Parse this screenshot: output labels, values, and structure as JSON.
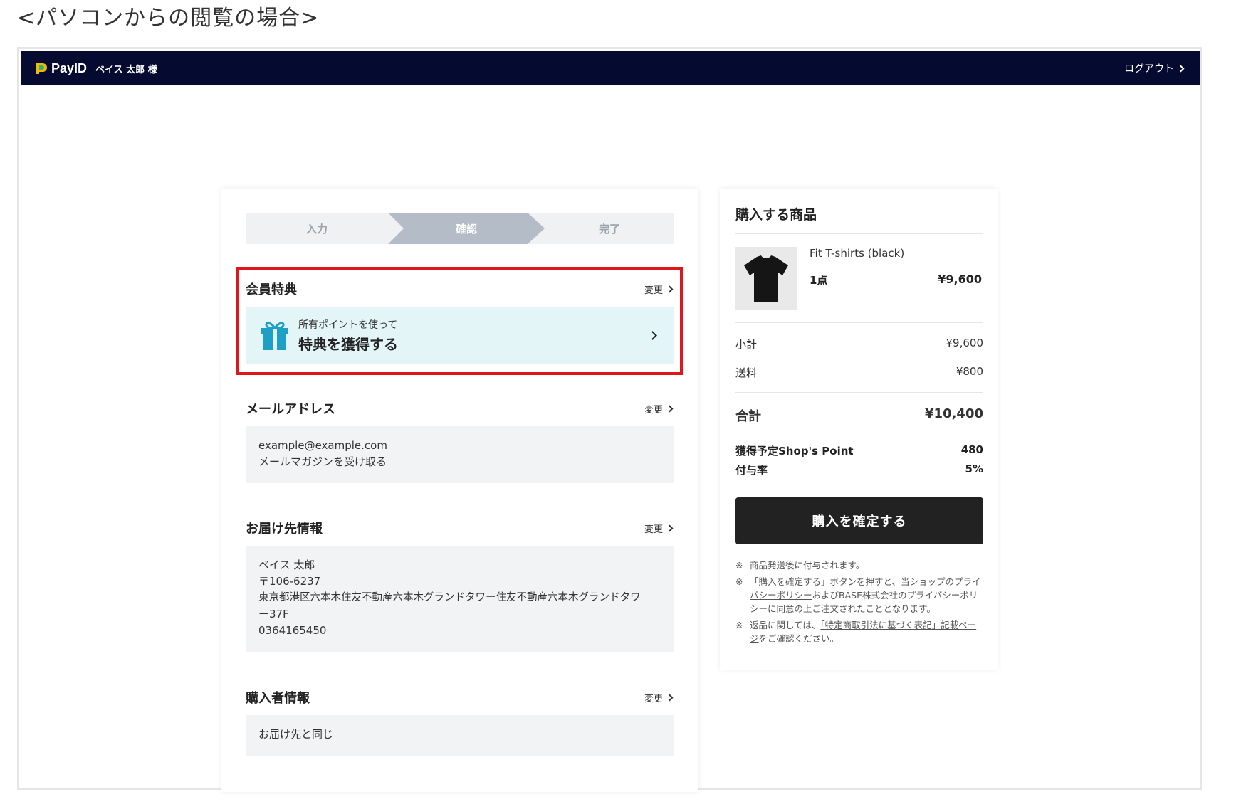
{
  "caption": "<パソコンからの閲覧の場合>",
  "header": {
    "brand": "PayID",
    "user": "ベイス 太郎 様",
    "logout": "ログアウト"
  },
  "stepper": {
    "steps": [
      "入力",
      "確認",
      "完了"
    ],
    "active_index": 1
  },
  "member_benefit": {
    "title": "会員特典",
    "change": "変更",
    "sub": "所有ポイントを使って",
    "main": "特典を獲得する"
  },
  "email": {
    "title": "メールアドレス",
    "change": "変更",
    "address": "example@example.com",
    "newsletter": "メールマガジンを受け取る"
  },
  "shipping": {
    "title": "お届け先情報",
    "change": "変更",
    "name": "ベイス 太郎",
    "postal": "〒106-6237",
    "address_line1": "東京都港区六本木住友不動産六本木グランドタワー住友不動産六本木グランドタワ",
    "address_line2": "ー37F",
    "phone": "0364165450"
  },
  "buyer": {
    "title": "購入者情報",
    "change": "変更",
    "value": "お届け先と同じ"
  },
  "order": {
    "title": "購入する商品",
    "product_name": "Fit T-shirts (black)",
    "quantity": "1点",
    "price": "¥9,600",
    "subtotal_label": "小計",
    "subtotal": "¥9,600",
    "shipping_label": "送料",
    "shipping": "¥800",
    "total_label": "合計",
    "total": "¥10,400",
    "points_label": "獲得予定Shop's Point",
    "points": "480",
    "rate_label": "付与率",
    "rate": "5%",
    "buy_button": "購入を確定する",
    "note1": "商品発送後に付与されます。",
    "note2_pre": "「購入を確定する」ボタンを押すと、当ショップの",
    "note2_link": "プライバシーポリシー",
    "note2_post": "およびBASE株式会社のプライバシーポリシーに同意の上ご注文されたこととなります。",
    "note3_pre": "返品に関しては、",
    "note3_link": "「特定商取引法に基づく表記」記載ページ",
    "note3_post": "をご確認ください。",
    "note_mark": "※"
  },
  "colors": {
    "header_bg": "#050a30",
    "highlight": "#e0161c",
    "benefit_bg": "#e4f5f8",
    "gift": "#1ea0c6"
  }
}
